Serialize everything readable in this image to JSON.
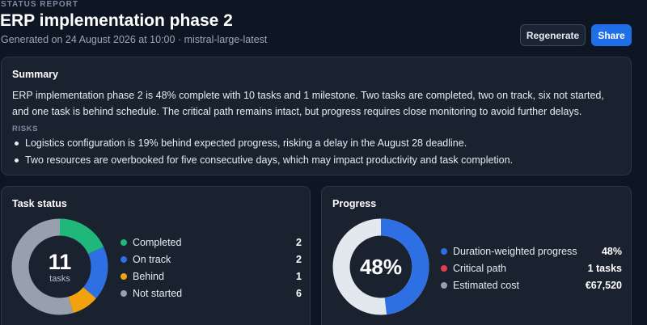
{
  "header": {
    "eyebrow": "STATUS REPORT",
    "title": "ERP implementation phase 2",
    "subtitle": "Generated on 24 August 2026 at 10:00 · mistral-large-latest",
    "regenerate_label": "Regenerate",
    "share_label": "Share"
  },
  "summary": {
    "title": "Summary",
    "text": "ERP implementation phase 2 is 48% complete with 10 tasks and 1 milestone. Two tasks are completed, two on track, six not started, and one task is behind schedule. The critical path remains intact, but progress requires close monitoring to avoid further delays.",
    "risks_label": "RISKS",
    "risks": [
      "Logistics configuration is 19% behind expected progress, risking a delay in the August 28 deadline.",
      "Two resources are overbooked for five consecutive days, which may impact productivity and task completion."
    ]
  },
  "task_status": {
    "title": "Task status",
    "total": "11",
    "total_caption": "tasks",
    "items": [
      {
        "label": "Completed",
        "value": "2",
        "color": "#1fb87a"
      },
      {
        "label": "On track",
        "value": "2",
        "color": "#2f6fe4"
      },
      {
        "label": "Behind",
        "value": "1",
        "color": "#f2a20f"
      },
      {
        "label": "Not started",
        "value": "6",
        "color": "#97a0ad"
      }
    ]
  },
  "progress": {
    "title": "Progress",
    "percent_label": "48%",
    "percent": 48,
    "fill_color": "#2f6fe4",
    "track_color": "#e3e8ef",
    "items": [
      {
        "label": "Duration-weighted progress",
        "value": "48%",
        "color": "#2f6fe4"
      },
      {
        "label": "Critical path",
        "value": "1 tasks",
        "color": "#e63a4f"
      },
      {
        "label": "Estimated cost",
        "value": "€67,520",
        "color": "#97a0ad"
      }
    ]
  }
}
